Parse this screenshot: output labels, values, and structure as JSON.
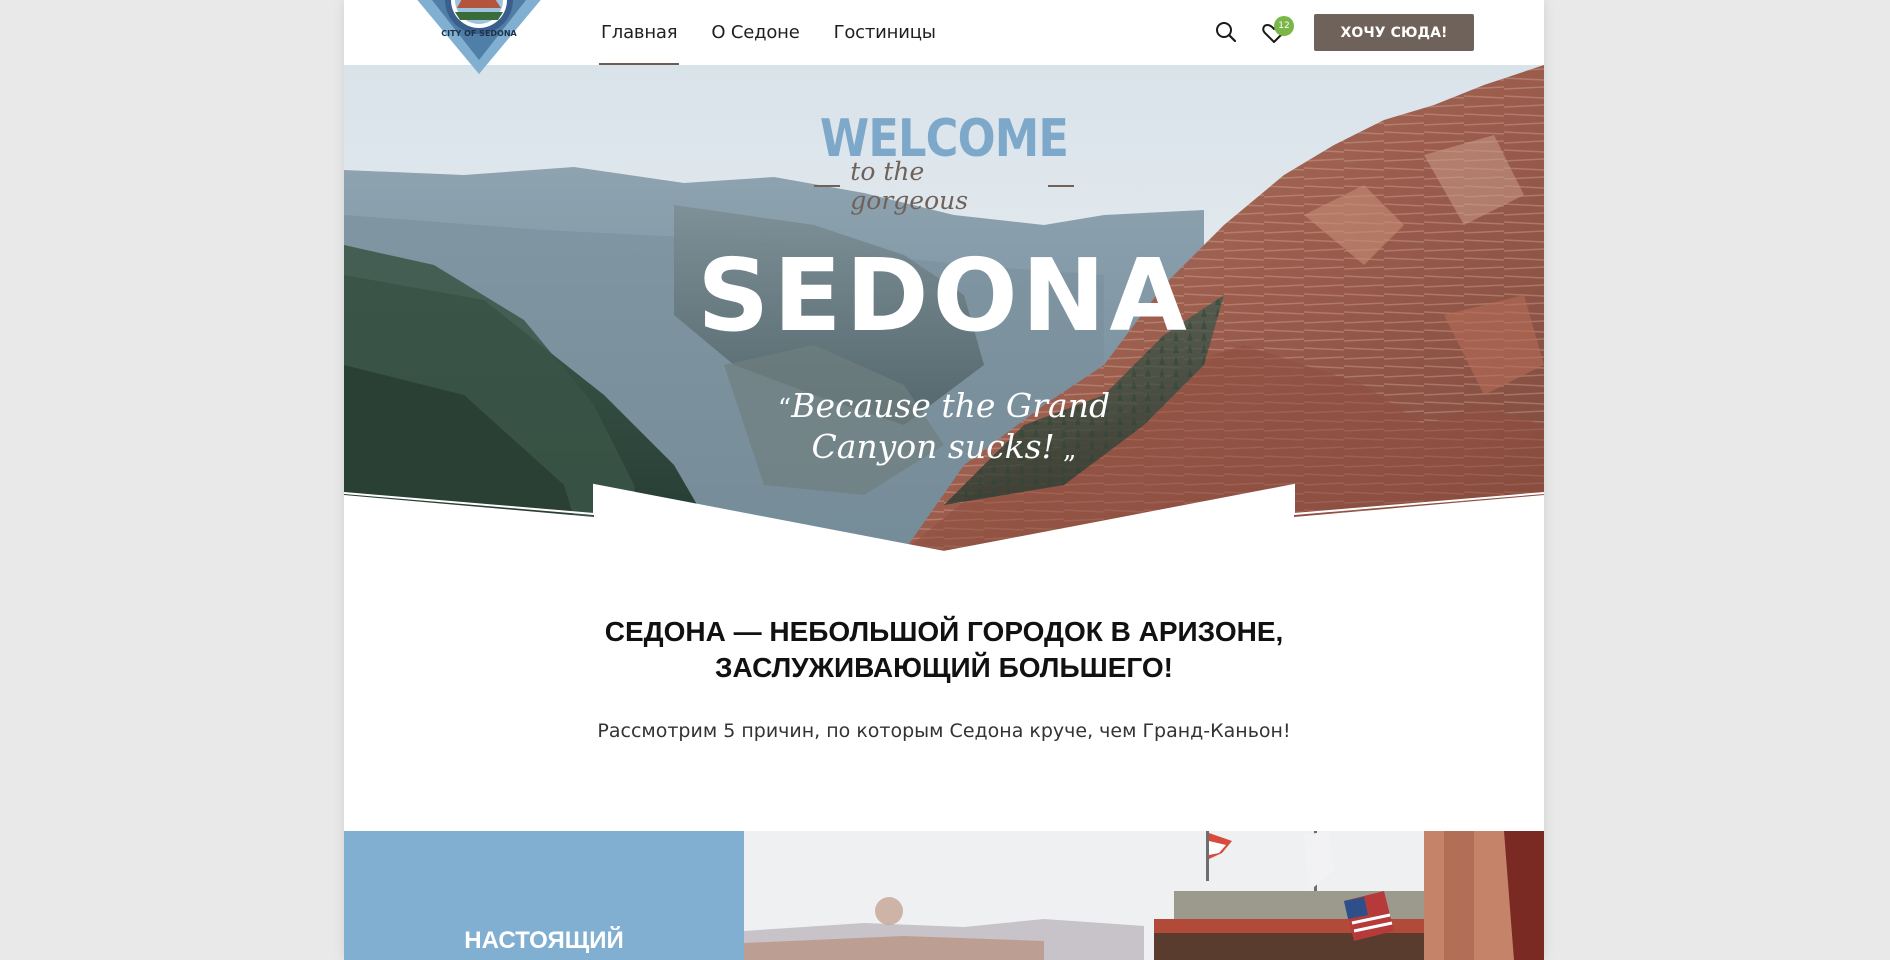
{
  "header": {
    "logo_text": "CITY OF SEDONA",
    "nav": [
      {
        "label": "Главная",
        "active": true
      },
      {
        "label": "О Седоне",
        "active": false
      },
      {
        "label": "Гостиницы",
        "active": false
      }
    ],
    "search_icon": "search-icon",
    "favorites_icon": "heart-icon",
    "favorites_count": "12",
    "cta_label": "ХОЧУ СЮДА!"
  },
  "hero": {
    "welcome": "WELCOME",
    "subline": "to the gorgeous",
    "title": "SEDONA",
    "quote_line1": "Because the Grand",
    "quote_line2": "Canyon sucks!"
  },
  "intro": {
    "title_line1": "СЕДОНА — НЕБОЛЬШОЙ ГОРОДОК В АРИЗОНЕ,",
    "title_line2": "ЗАСЛУЖИВАЮЩИЙ БОЛЬШЕГО!",
    "text": "Рассмотрим 5 причин, по которым Седона круче, чем Гранд-Каньон!"
  },
  "section1": {
    "title": "НАСТОЯЩИЙ"
  },
  "colors": {
    "accent_blue": "#80afd1",
    "brown": "#6f625a",
    "badge_green": "#7ab648",
    "page_bg": "#e9e9e9"
  }
}
